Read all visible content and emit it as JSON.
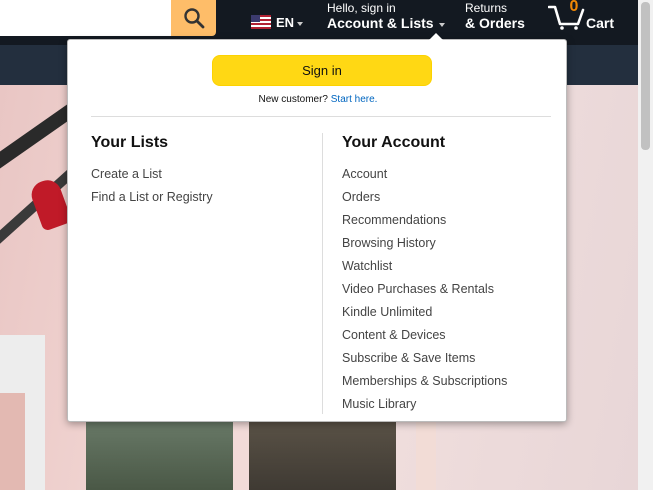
{
  "header": {
    "language": "EN",
    "account_greeting": "Hello, sign in",
    "account_label": "Account & Lists",
    "returns_line1": "Returns",
    "returns_line2": "& Orders",
    "cart_count": "0",
    "cart_label": "Cart"
  },
  "flyout": {
    "signin_label": "Sign in",
    "new_customer_text": "New customer?",
    "start_here_label": "Start here.",
    "lists": {
      "title": "Your Lists",
      "items": [
        "Create a List",
        "Find a List or Registry"
      ]
    },
    "account": {
      "title": "Your Account",
      "items": [
        "Account",
        "Orders",
        "Recommendations",
        "Browsing History",
        "Watchlist",
        "Video Purchases & Rentals",
        "Kindle Unlimited",
        "Content & Devices",
        "Subscribe & Save Items",
        "Memberships & Subscriptions",
        "Music Library"
      ]
    }
  },
  "colors": {
    "nav_dark": "#131921",
    "nav_sub": "#232f3e",
    "search_button": "#febd69",
    "signin_button": "#ffd814",
    "cart_count": "#f08804",
    "link": "#0066c0"
  }
}
